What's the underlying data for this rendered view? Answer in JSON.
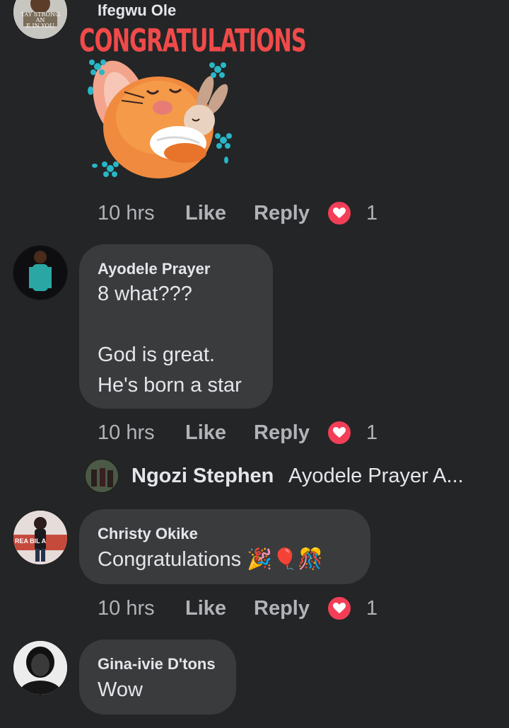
{
  "comments": [
    {
      "author": "Ifegwu Ole",
      "avatar_text": "TAY STRONG AN\nE IN YOU",
      "sticker_text": "CONGRATULATIONS",
      "time": "10 hrs",
      "like": "Like",
      "reply": "Reply",
      "reactions": "1"
    },
    {
      "author": "Ayodele Prayer",
      "text": "8 what???\n\nGod is great.\nHe's born a star",
      "time": "10 hrs",
      "like": "Like",
      "reply": "Reply",
      "reactions": "1"
    },
    {
      "author": "Christy Okike",
      "avatar_text": "REA BIL A",
      "text": "Congratulations 🎉🎈🎊",
      "time": "10 hrs",
      "like": "Like",
      "reply": "Reply",
      "reactions": "1"
    },
    {
      "author": "Gina-ivie D'tons",
      "text": "Wow"
    }
  ],
  "reply_preview": {
    "author": "Ngozi Stephen",
    "snippet": "Ayodele Prayer A..."
  },
  "colors": {
    "background": "#242526",
    "bubble": "#3a3b3c",
    "heart": "#f33e58",
    "secondary_text": "#b0b3b8",
    "primary_text": "#e4e6eb"
  }
}
